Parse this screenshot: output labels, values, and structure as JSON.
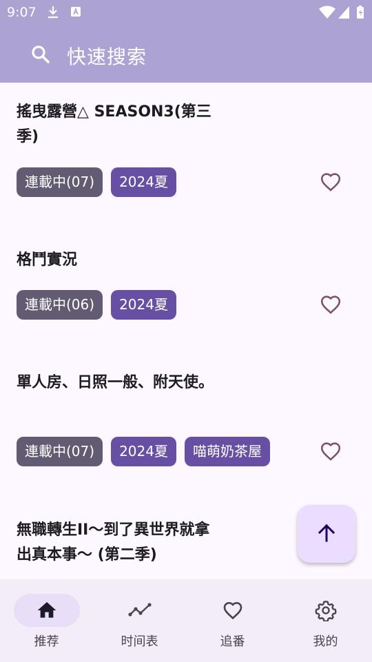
{
  "status_bar": {
    "time": "9:07",
    "icons": [
      "download-icon",
      "a-notification-icon",
      "wifi-icon",
      "signal-icon",
      "battery-charging-icon"
    ]
  },
  "search": {
    "placeholder": "快速搜索",
    "icon": "search-icon"
  },
  "list": {
    "items": [
      {
        "title": "搖曳露營△ SEASON3(第三季)",
        "tags": [
          "連載中(07)",
          "2024夏"
        ],
        "favorite_icon": "heart-outline-icon"
      },
      {
        "title": "格鬥實況",
        "tags": [
          "連載中(06)",
          "2024夏"
        ],
        "favorite_icon": "heart-outline-icon"
      },
      {
        "title": "單人房、日照一般、附天使。",
        "tags": [
          "連載中(07)",
          "2024夏",
          "喵萌奶茶屋"
        ],
        "favorite_icon": "heart-outline-icon"
      },
      {
        "title": "無職轉生II～到了異世界就拿出真本事～ (第二季)",
        "tags": [],
        "favorite_icon": "heart-outline-icon"
      }
    ]
  },
  "fab": {
    "icon": "arrow-up-icon"
  },
  "bottom_nav": {
    "items": [
      {
        "label": "推荐",
        "icon": "home-icon",
        "selected": true
      },
      {
        "label": "时间表",
        "icon": "timeline-icon",
        "selected": false
      },
      {
        "label": "追番",
        "icon": "heart-icon",
        "selected": false
      },
      {
        "label": "我的",
        "icon": "gear-icon",
        "selected": false
      }
    ]
  },
  "colors": {
    "header": "#ada3d2",
    "status_chip": "#625b71",
    "season_chip": "#6750a4",
    "fab": "#eaddff",
    "nav_bg": "#f3edf7",
    "nav_selected": "#e8def8"
  }
}
